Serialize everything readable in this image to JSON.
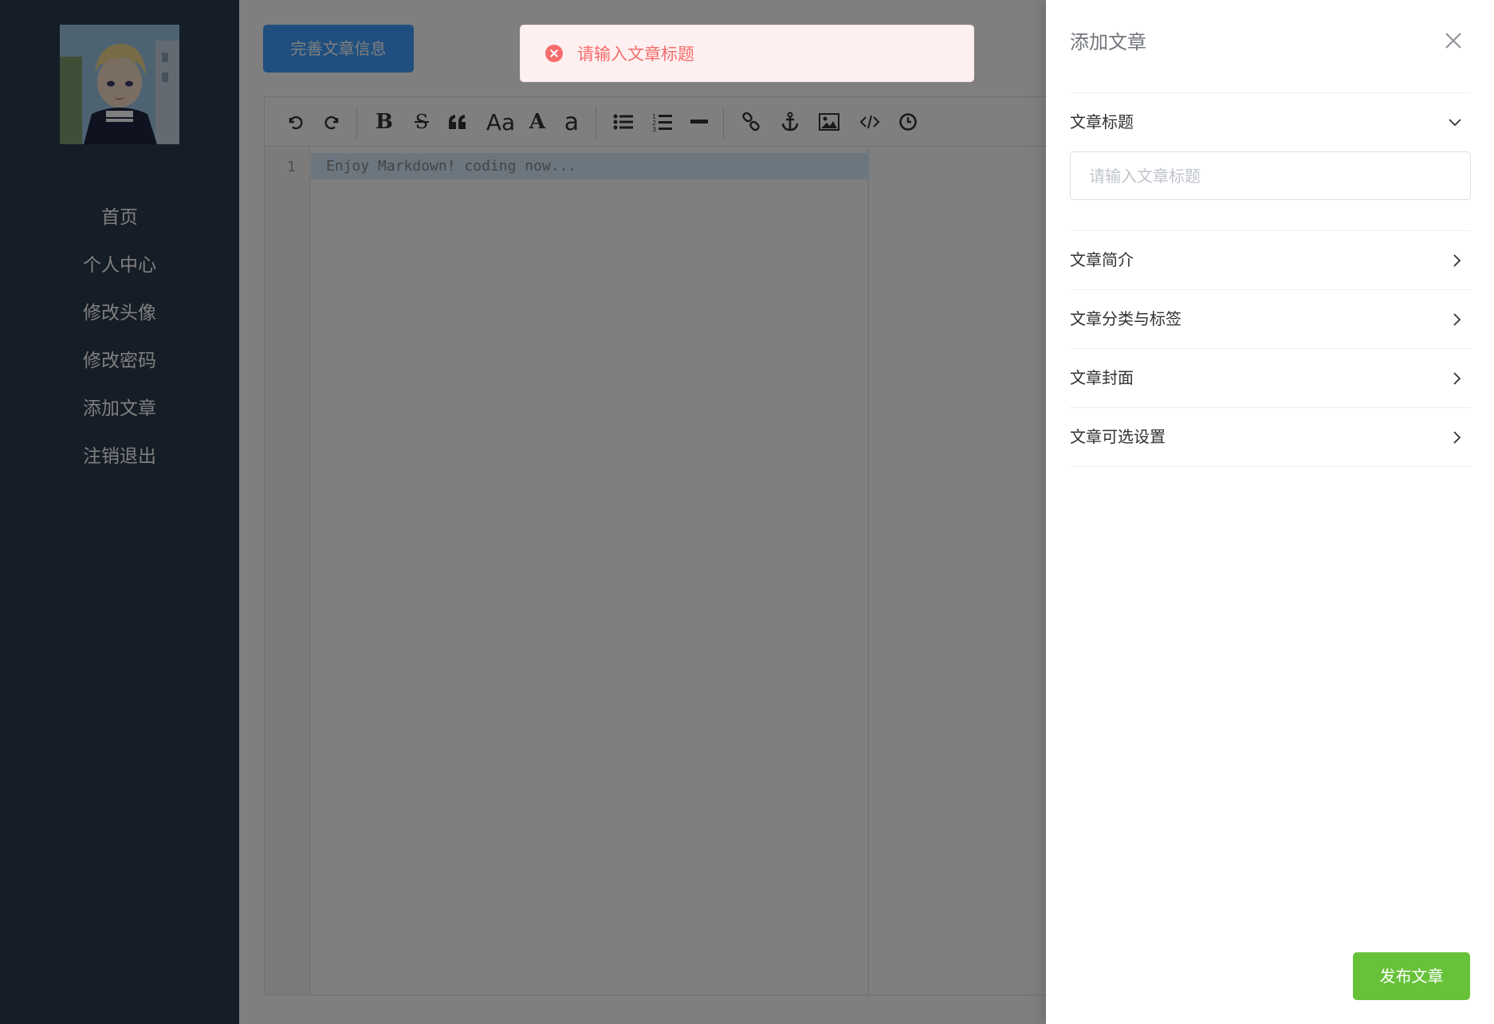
{
  "sidebar": {
    "avatar_alt": "",
    "nav_items": [
      "首页",
      "个人中心",
      "修改头像",
      "修改密码",
      "添加文章",
      "注销退出"
    ]
  },
  "main": {
    "complete_button_label": "完善文章信息"
  },
  "editor": {
    "line_number": "1",
    "placeholder_text": "Enjoy Markdown! coding now...",
    "toolbar": {
      "heading_label": "Aa",
      "uppercase_label": "A",
      "lowercase_label": "a",
      "icons": [
        "undo-icon",
        "redo-icon",
        "bold-icon",
        "strikethrough-icon",
        "quote-icon",
        "heading-icon",
        "uppercase-icon",
        "lowercase-icon",
        "unordered-list-icon",
        "ordered-list-icon",
        "horizontal-rule-icon",
        "link-icon",
        "anchor-icon",
        "image-icon",
        "code-icon",
        "datetime-icon"
      ]
    }
  },
  "toast": {
    "type": "error",
    "message": "请输入文章标题"
  },
  "drawer": {
    "title": "添加文章",
    "sections": [
      {
        "label": "文章标题",
        "expanded": true
      },
      {
        "label": "文章简介",
        "expanded": false
      },
      {
        "label": "文章分类与标签",
        "expanded": false
      },
      {
        "label": "文章封面",
        "expanded": false
      },
      {
        "label": "文章可选设置",
        "expanded": false
      }
    ],
    "title_input": {
      "value": "",
      "placeholder": "请输入文章标题"
    },
    "publish_button_label": "发布文章"
  },
  "colors": {
    "sidebar_bg": "#2b3a4f",
    "primary": "#409eff",
    "success": "#67c23a",
    "error": "#f56c6c",
    "error_bg": "#fef0f0"
  }
}
